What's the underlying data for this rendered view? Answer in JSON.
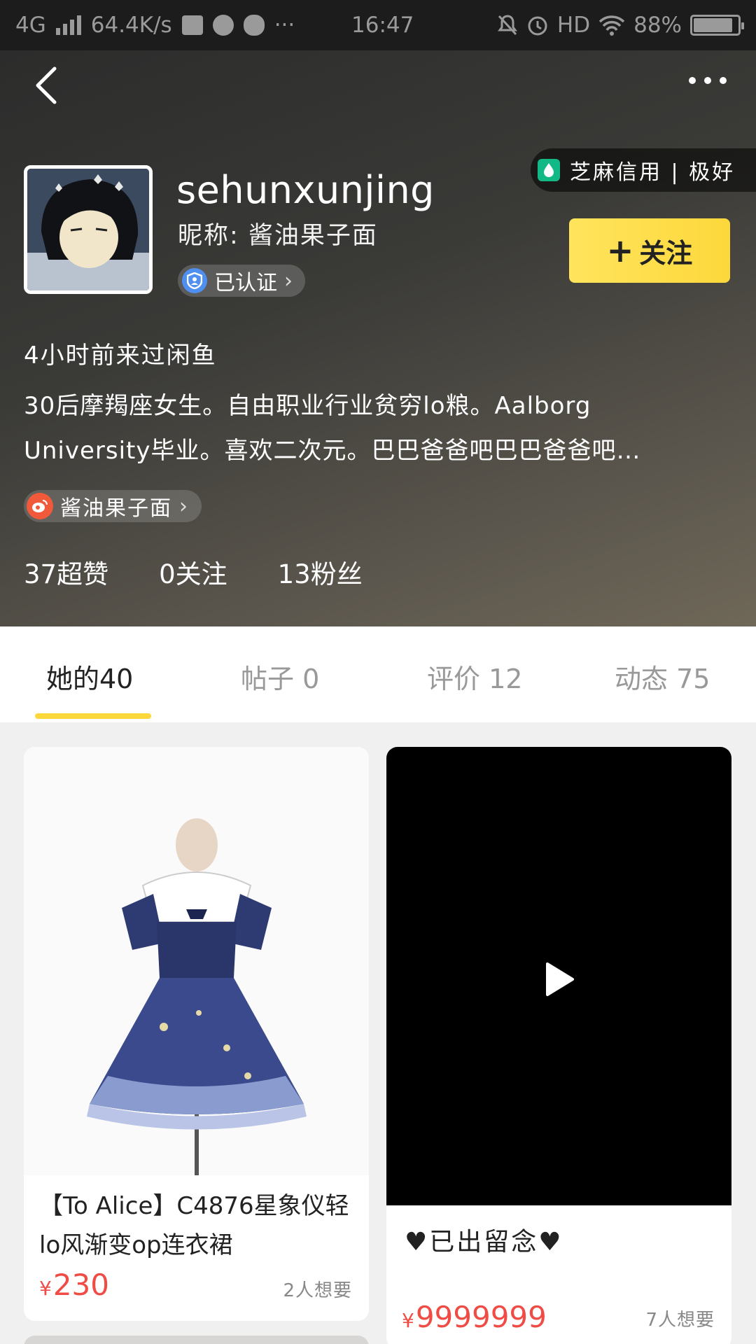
{
  "status_bar": {
    "network": "4G",
    "speed": "64.4K/s",
    "time": "16:47",
    "hd": "HD",
    "battery": "88%",
    "battery_level": 0.88
  },
  "profile": {
    "username": "sehunxunjing",
    "nickname": "昵称: 酱油果子面",
    "verified_label": "已认证",
    "credit_label": "芝麻信用 | 极好",
    "follow_label": "关注",
    "last_visit": "4小时前来过闲鱼",
    "bio": "30后摩羯座女生。自由职业行业贫穷lo粮。Aalborg University毕业。喜欢二次元。巴巴爸爸吧巴巴爸爸吧…",
    "weibo_label": "酱油果子面",
    "stats": {
      "likes": "37超赞",
      "following": "0关注",
      "fans": "13粉丝"
    }
  },
  "tabs": [
    {
      "label": "她的40"
    },
    {
      "label": "帖子 0"
    },
    {
      "label": "评价 12"
    },
    {
      "label": "动态 75"
    }
  ],
  "items": [
    {
      "title": "【To Alice】C4876星象仪轻lo风渐变op连衣裙",
      "currency": "¥",
      "price": "230",
      "want": "2人想要"
    },
    {
      "title": "♥已出留念♥",
      "currency": "¥",
      "price": "9999999",
      "want": "7人想要"
    }
  ],
  "colors": {
    "accent_yellow": "#fdd83c",
    "price_red": "#f04b44",
    "credit_green": "#12b886",
    "verify_blue": "#4e8ff0"
  }
}
